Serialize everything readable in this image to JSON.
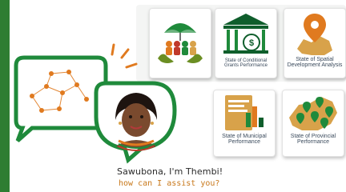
{
  "left_accent": "#2e7d32",
  "brand": {
    "green": "#1f8a3b",
    "dark_green": "#0f5e2c",
    "orange": "#e07a1f",
    "gold": "#d8a24a"
  },
  "cards": [
    {
      "id": "people",
      "label": "",
      "icon": "umbrella-people-icon"
    },
    {
      "id": "conditional-grants",
      "label": "State of Conditional Grants Performance",
      "icon": "building-coin-icon"
    },
    {
      "id": "spatial-development",
      "label": "State of Spatial Development Analysis",
      "icon": "map-pin-icon"
    },
    {
      "id": "municipal",
      "label": "State of Municipal Performance",
      "icon": "report-chart-icon"
    },
    {
      "id": "provincial",
      "label": "State of Provincial Performance",
      "icon": "map-markers-icon"
    }
  ],
  "assistant": {
    "greeting": "Sawubona, I'm Thembi!",
    "prompt": "how can I assist you?",
    "avatar_icon": "thembi-avatar-icon"
  }
}
